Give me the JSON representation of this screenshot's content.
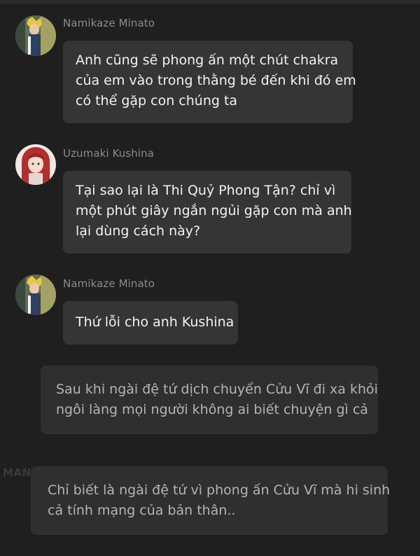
{
  "messages": [
    {
      "sender": "Namikaze Minato",
      "avatar": "minato-avatar",
      "lines": [
        "Anh cũng sẽ phong ấn một chút chakra",
        "của em vào trong thằng bé đến khi đó em",
        "có thể gặp con chúng ta"
      ]
    },
    {
      "sender": "Uzumaki Kushina",
      "avatar": "kushina-avatar",
      "lines": [
        "Tại sao lại là Thi Quỷ Phong Tận? chỉ vì",
        "một phút giây ngắn ngủi gặp con mà anh",
        "lại dùng cách này?"
      ]
    },
    {
      "sender": "Namikaze Minato",
      "avatar": "minato-avatar",
      "lines": [
        "Thứ lỗi cho anh Kushina"
      ]
    }
  ],
  "narrations": [
    {
      "lines": [
        "Sau khi ngài đệ tứ dịch chuyển Cửu Vĩ đi xa khỏi",
        "ngôi làng mọi người không ai biết chuyện gì cả"
      ]
    },
    {
      "lines": [
        "Chỉ biết là ngài đệ tứ vì phong ấn Cửu Vĩ mà hi sinh",
        "cả tính mạng của bản thân.."
      ]
    }
  ],
  "watermark": "MANGATOON",
  "colors": {
    "background": "#1f1f1f",
    "bubble": "#353535",
    "narration": "#2f2f2f",
    "sender_text": "#8c8c8c",
    "message_text": "#f2f2f2",
    "narration_text": "#b4b4b4"
  }
}
